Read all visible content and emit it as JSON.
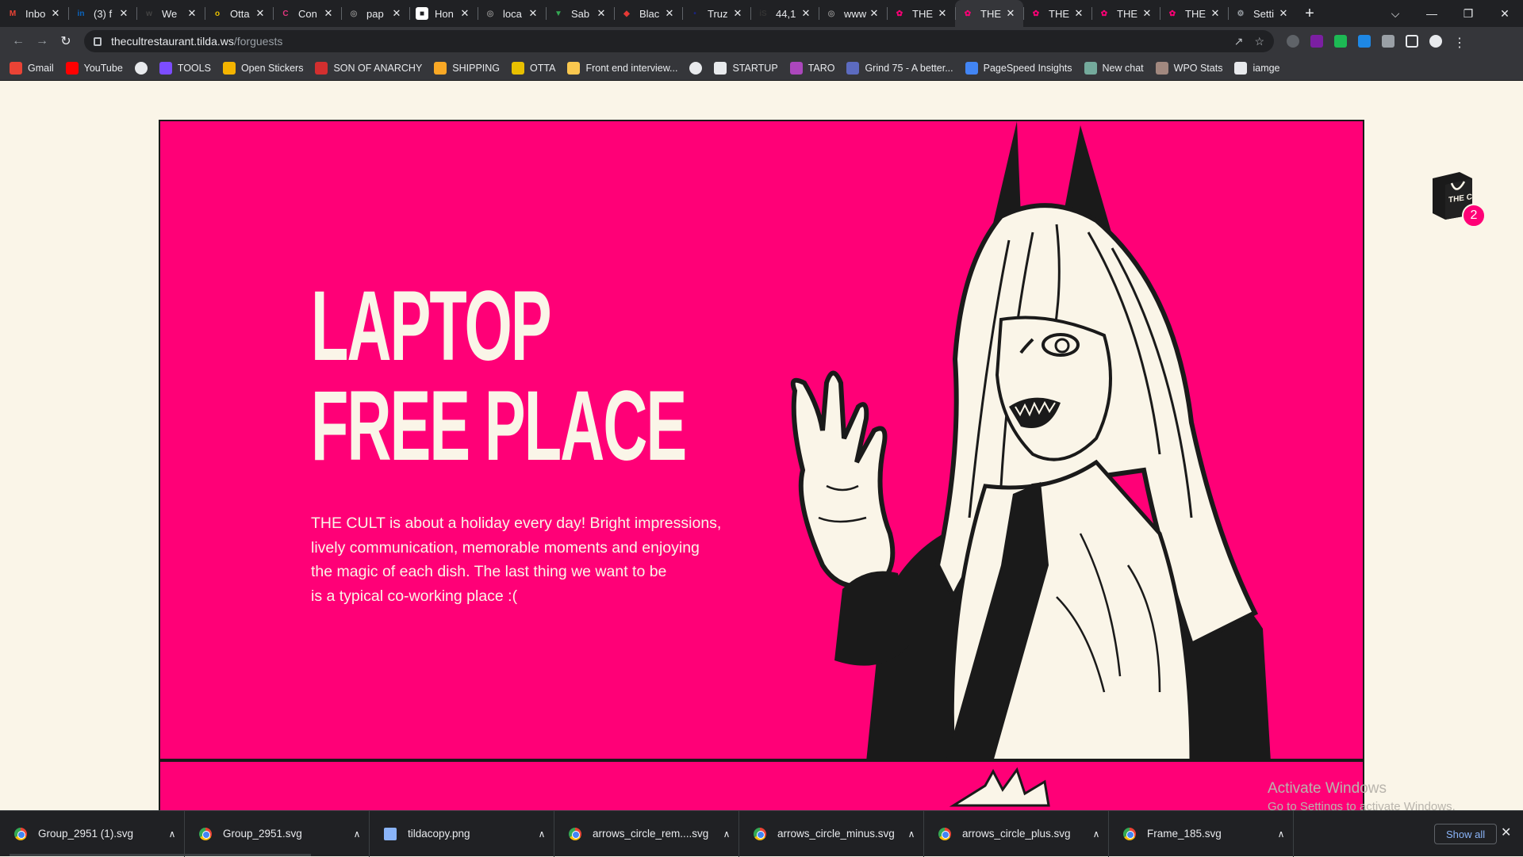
{
  "browser": {
    "tabs": [
      {
        "label": "Inbo",
        "color": "#ea4335",
        "glyph": "M"
      },
      {
        "label": "(3) f",
        "color": "#0a66c2",
        "glyph": "in"
      },
      {
        "label": "We",
        "color": "#444",
        "glyph": "w"
      },
      {
        "label": "Otta",
        "color": "#e8c000",
        "glyph": "o"
      },
      {
        "label": "Con",
        "color": "#e5357f",
        "glyph": "C"
      },
      {
        "label": "pap",
        "color": "#888",
        "glyph": "◎"
      },
      {
        "label": "Hon",
        "color": "#fff",
        "glyph": "■"
      },
      {
        "label": "loca",
        "color": "#888",
        "glyph": "◎"
      },
      {
        "label": "Sab",
        "color": "#34a853",
        "glyph": "▼"
      },
      {
        "label": "Blac",
        "color": "#e53935",
        "glyph": "◆"
      },
      {
        "label": "Truz",
        "color": "#1a237e",
        "glyph": "•"
      },
      {
        "label": "44,1",
        "color": "#333",
        "glyph": "iS"
      },
      {
        "label": "www",
        "color": "#888",
        "glyph": "◎"
      },
      {
        "label": "THE",
        "color": "#ff0077",
        "glyph": "✿"
      },
      {
        "label": "THE",
        "color": "#ff0077",
        "glyph": "✿",
        "active": true
      },
      {
        "label": "THE",
        "color": "#ff0077",
        "glyph": "✿"
      },
      {
        "label": "THE",
        "color": "#ff0077",
        "glyph": "✿"
      },
      {
        "label": "THE",
        "color": "#ff0077",
        "glyph": "✿"
      },
      {
        "label": "Setti",
        "color": "#9aa0a6",
        "glyph": "⚙"
      }
    ],
    "url_host": "thecultrestaurant.tilda.ws",
    "url_path": "/forguests",
    "bookmarks": [
      {
        "label": "Gmail",
        "color": "#ea4335"
      },
      {
        "label": "YouTube",
        "color": "#ff0000"
      },
      {
        "label": "",
        "color": "#e8eaed"
      },
      {
        "label": "TOOLS",
        "color": "#7c4dff"
      },
      {
        "label": "Open Stickers",
        "color": "#f4b400"
      },
      {
        "label": "SON OF ANARCHY",
        "color": "#d32f2f"
      },
      {
        "label": "SHIPPING",
        "color": "#f9a825"
      },
      {
        "label": "OTTA",
        "color": "#e8c000"
      },
      {
        "label": "Front end interview...",
        "color": "#f9c74f"
      },
      {
        "label": "",
        "color": "#e8eaed"
      },
      {
        "label": "STARTUP",
        "color": "#e8eaed"
      },
      {
        "label": "TARO",
        "color": "#ab47bc"
      },
      {
        "label": "Grind 75 - A better...",
        "color": "#5c6bc0"
      },
      {
        "label": "PageSpeed Insights",
        "color": "#4285f4"
      },
      {
        "label": "New chat",
        "color": "#74aa9c"
      },
      {
        "label": "WPO Stats",
        "color": "#a1887f"
      },
      {
        "label": "iamge",
        "color": "#e8eaed"
      }
    ]
  },
  "hero": {
    "title_line1": "LAPTOP",
    "title_line2": "FREE PLACE",
    "text_line1": "THE CULT is about a holiday every day! Bright impressions,",
    "text_line2": "lively communication, memorable moments and enjoying",
    "text_line3": "the magic of each dish. The last thing we want to be",
    "text_line4": "is a typical co-working place :("
  },
  "cart": {
    "count": "2",
    "bag_label": "THE CULT"
  },
  "watermark": {
    "line1": "Activate Windows",
    "line2": "Go to Settings to activate Windows."
  },
  "downloads": {
    "items": [
      {
        "name": "Group_2951 (1).svg",
        "type": "chrome"
      },
      {
        "name": "Group_2951.svg",
        "type": "chrome"
      },
      {
        "name": "tildacopy.png",
        "type": "doc"
      },
      {
        "name": "arrows_circle_rem....svg",
        "type": "chrome"
      },
      {
        "name": "arrows_circle_minus.svg",
        "type": "chrome"
      },
      {
        "name": "arrows_circle_plus.svg",
        "type": "chrome"
      },
      {
        "name": "Frame_185.svg",
        "type": "chrome"
      }
    ],
    "show_all": "Show all"
  },
  "colors": {
    "accent": "#ff0077",
    "cream": "#faf5e8",
    "ink": "#1a1a1a"
  }
}
